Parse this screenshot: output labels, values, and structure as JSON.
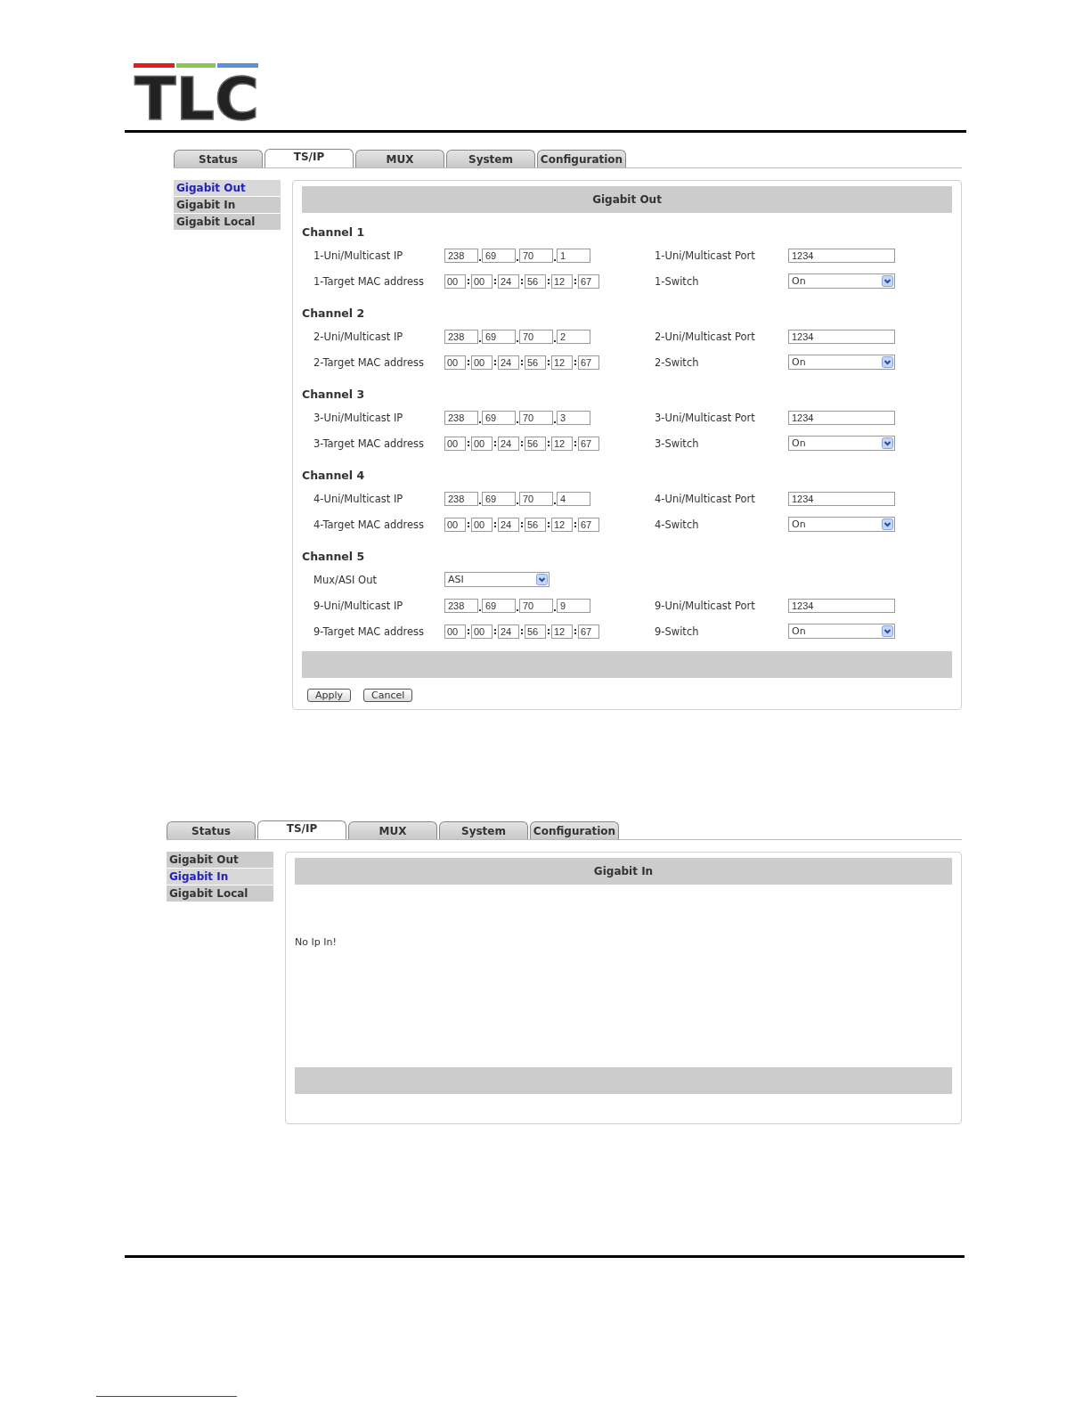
{
  "logo": {
    "text": "TLC"
  },
  "screens": [
    {
      "tabs": [
        {
          "label": "Status",
          "selected": false
        },
        {
          "label": "TS/IP",
          "selected": true
        },
        {
          "label": "MUX",
          "selected": false
        },
        {
          "label": "System",
          "selected": false
        },
        {
          "label": "Configuration",
          "selected": false
        }
      ],
      "sidebar": [
        {
          "label": "Gigabit Out",
          "selected": true
        },
        {
          "label": "Gigabit In",
          "selected": false
        },
        {
          "label": "Gigabit Local",
          "selected": false
        }
      ],
      "panel": {
        "kind": "form",
        "title": "Gigabit Out",
        "channels": [
          {
            "title": "Channel 1",
            "ip_label": "1-Uni/Multicast IP",
            "ip": [
              "238",
              "69",
              "70",
              "1"
            ],
            "port_label": "1-Uni/Multicast Port",
            "port": "1234",
            "mac_label": "1-Target MAC address",
            "mac": [
              "00",
              "00",
              "24",
              "56",
              "12",
              "67"
            ],
            "switch_label": "1-Switch",
            "switch": "On"
          },
          {
            "title": "Channel 2",
            "ip_label": "2-Uni/Multicast IP",
            "ip": [
              "238",
              "69",
              "70",
              "2"
            ],
            "port_label": "2-Uni/Multicast Port",
            "port": "1234",
            "mac_label": "2-Target MAC address",
            "mac": [
              "00",
              "00",
              "24",
              "56",
              "12",
              "67"
            ],
            "switch_label": "2-Switch",
            "switch": "On"
          },
          {
            "title": "Channel 3",
            "ip_label": "3-Uni/Multicast IP",
            "ip": [
              "238",
              "69",
              "70",
              "3"
            ],
            "port_label": "3-Uni/Multicast Port",
            "port": "1234",
            "mac_label": "3-Target MAC address",
            "mac": [
              "00",
              "00",
              "24",
              "56",
              "12",
              "67"
            ],
            "switch_label": "3-Switch",
            "switch": "On"
          },
          {
            "title": "Channel 4",
            "ip_label": "4-Uni/Multicast IP",
            "ip": [
              "238",
              "69",
              "70",
              "4"
            ],
            "port_label": "4-Uni/Multicast Port",
            "port": "1234",
            "mac_label": "4-Target MAC address",
            "mac": [
              "00",
              "00",
              "24",
              "56",
              "12",
              "67"
            ],
            "switch_label": "4-Switch",
            "switch": "On"
          },
          {
            "title": "Channel 5",
            "mux_out": {
              "label": "Mux/ASI Out",
              "value": "ASI"
            },
            "ip_label": "9-Uni/Multicast IP",
            "ip": [
              "238",
              "69",
              "70",
              "9"
            ],
            "port_label": "9-Uni/Multicast Port",
            "port": "1234",
            "mac_label": "9-Target MAC address",
            "mac": [
              "00",
              "00",
              "24",
              "56",
              "12",
              "67"
            ],
            "switch_label": "9-Switch",
            "switch": "On"
          }
        ],
        "buttons": [
          "Apply",
          "Cancel"
        ]
      }
    },
    {
      "tabs": [
        {
          "label": "Status",
          "selected": false
        },
        {
          "label": "TS/IP",
          "selected": true
        },
        {
          "label": "MUX",
          "selected": false
        },
        {
          "label": "System",
          "selected": false
        },
        {
          "label": "Configuration",
          "selected": false
        }
      ],
      "sidebar": [
        {
          "label": "Gigabit Out",
          "selected": false
        },
        {
          "label": "Gigabit In",
          "selected": true
        },
        {
          "label": "Gigabit Local",
          "selected": false
        }
      ],
      "panel": {
        "kind": "message",
        "title": "Gigabit In",
        "message": "No Ip In!"
      }
    }
  ]
}
